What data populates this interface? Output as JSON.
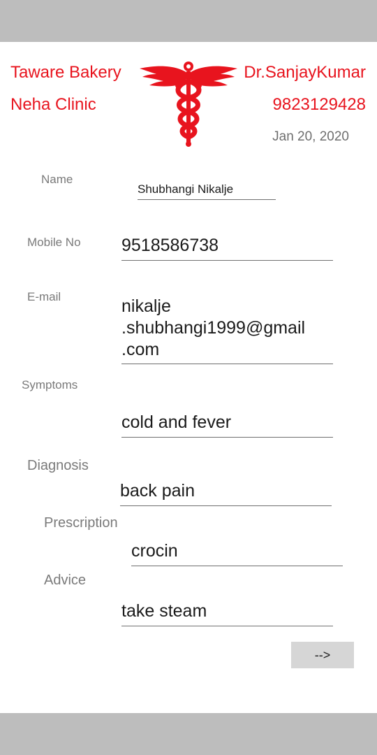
{
  "header": {
    "clinic_title": "Taware Bakery",
    "clinic_name": "Neha Clinic",
    "doctor_name": "Dr.SanjayKumar",
    "doctor_phone": "9823129428",
    "date": "Jan 20, 2020",
    "logo_icon": "caduceus-icon",
    "accent_color": "#e8141e"
  },
  "form": {
    "name_label": "Name",
    "name_value": "Shubhangi Nikalje",
    "mobile_label": "Mobile No",
    "mobile_value": "9518586738",
    "email_label": "E-mail",
    "email_value": "nikalje\n.shubhangi1999@gmail\n.com",
    "symptoms_label": "Symptoms",
    "symptoms_value": "cold and fever",
    "diagnosis_label": "Diagnosis",
    "diagnosis_value": "back pain",
    "prescription_label": "Prescription",
    "prescription_value": "crocin",
    "advice_label": "Advice",
    "advice_value": "take steam"
  },
  "actions": {
    "next_label": "-->"
  }
}
